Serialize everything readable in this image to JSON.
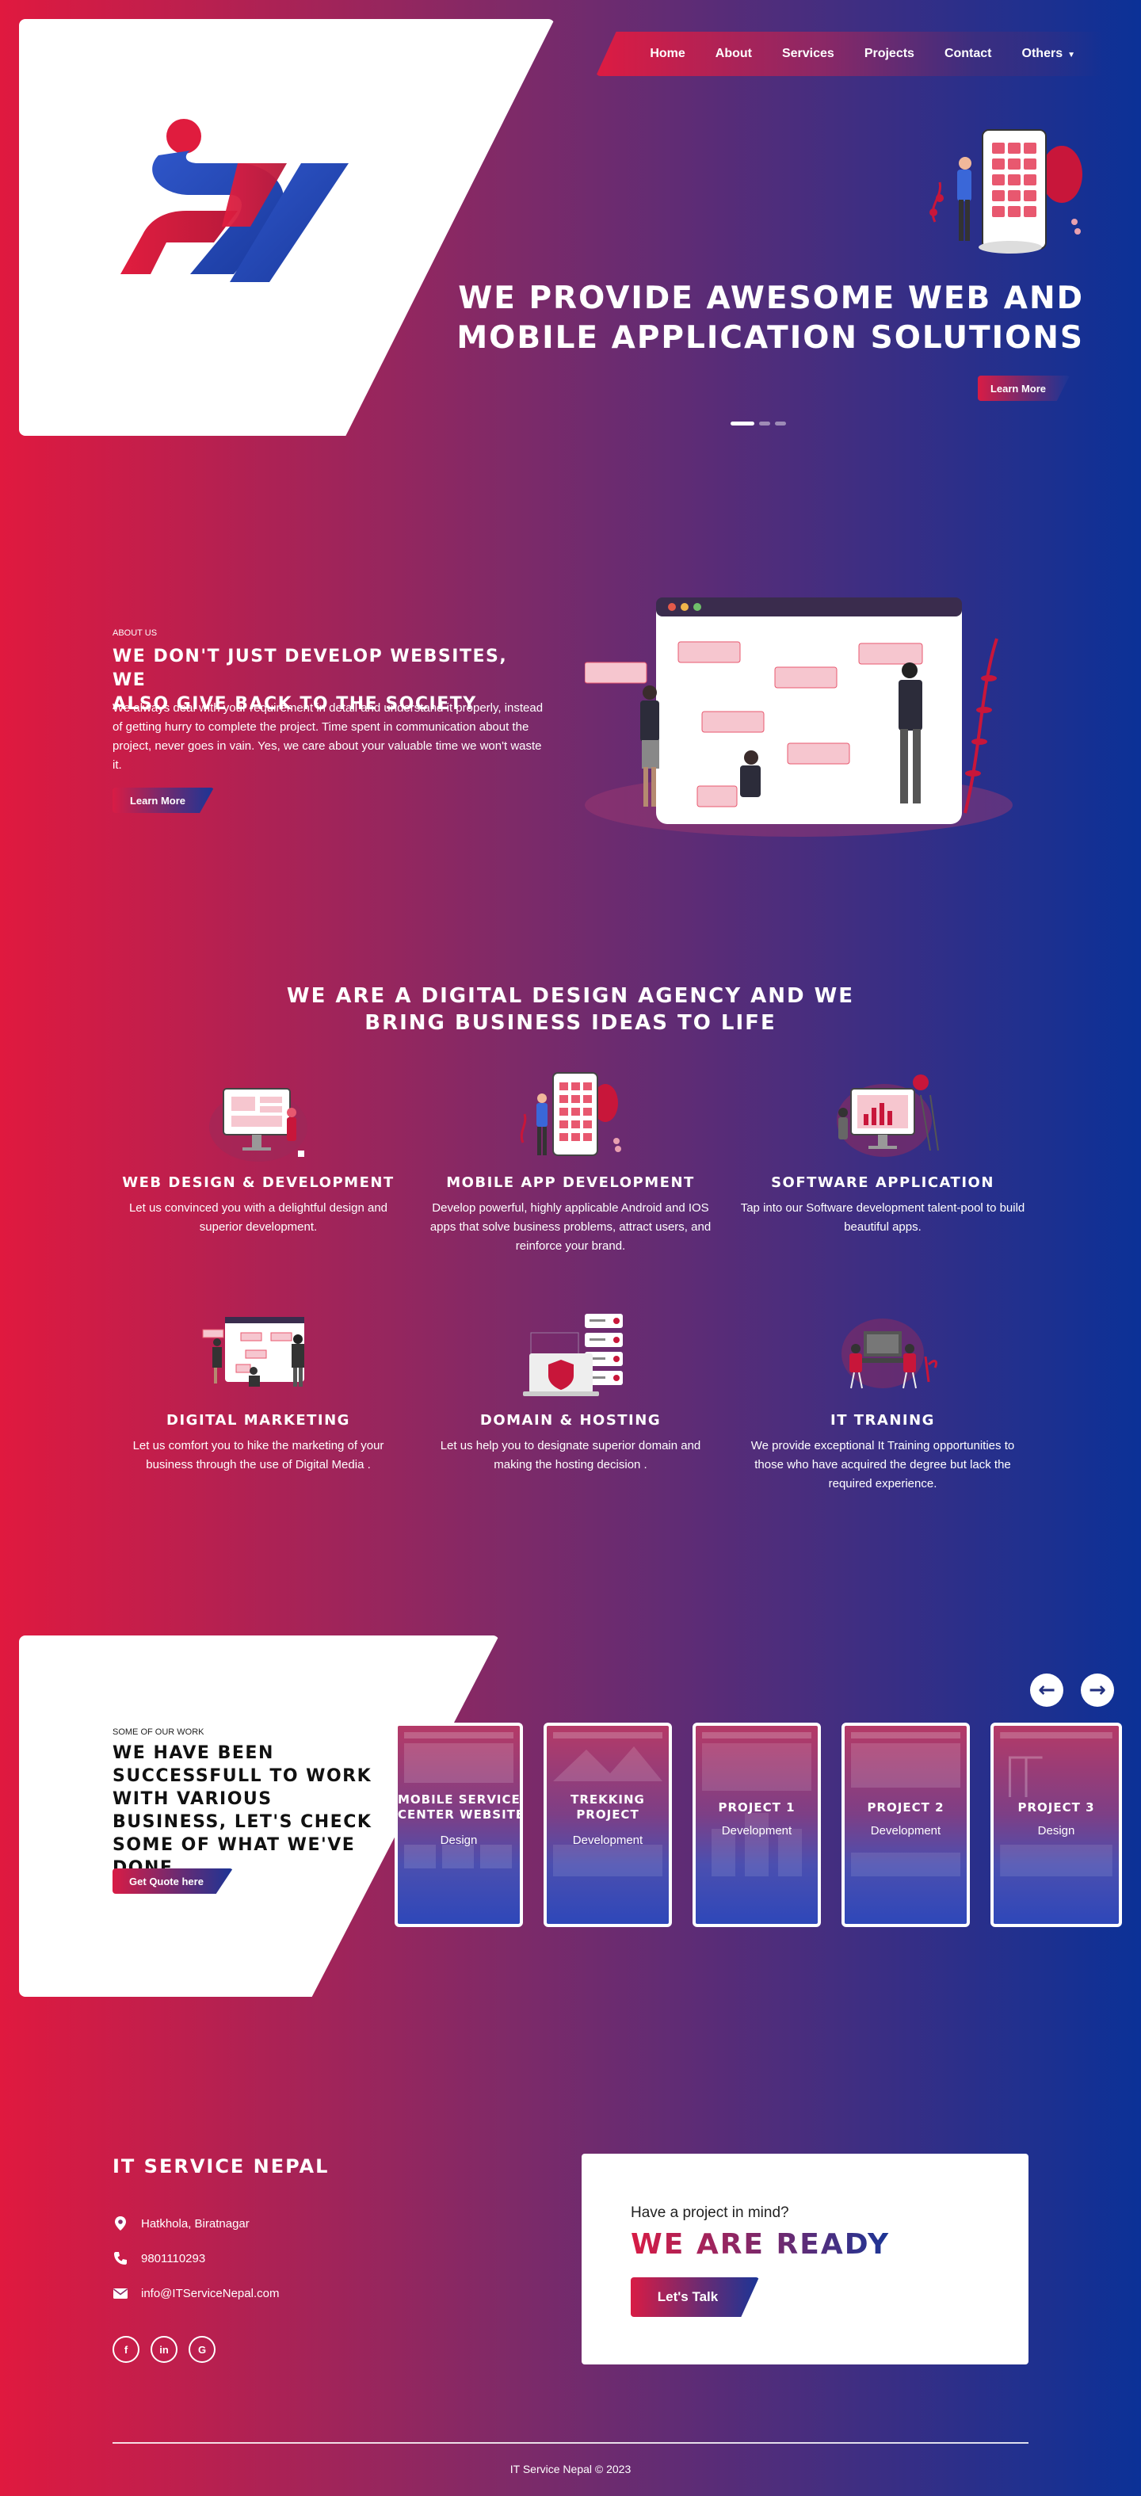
{
  "nav": {
    "items": [
      "Home",
      "About",
      "Services",
      "Projects",
      "Contact",
      "Others"
    ]
  },
  "hero": {
    "title_line1": "WE PROVIDE AWESOME WEB AND",
    "title_line2": "MOBILE APPLICATION SOLUTIONS",
    "button": "Learn More",
    "slides": {
      "count": 3,
      "active": 1
    }
  },
  "about": {
    "eyebrow": "ABOUT US",
    "title_line1": "WE DON'T JUST DEVELOP WEBSITES, WE",
    "title_line2": "ALSO GIVE BACK TO THE SOCIETY",
    "text": "We always deal with your requirement in detail and understand it properly, instead of getting hurry to complete the project. Time spent in communication about the project, never goes in vain. Yes, we care about your valuable time we won't waste it.",
    "button": "Learn More"
  },
  "services": {
    "title_line1": "WE ARE A DIGITAL DESIGN AGENCY AND WE",
    "title_line2": "BRING BUSINESS IDEAS TO LIFE",
    "items": [
      {
        "title": "WEB DESIGN & DEVELOPMENT",
        "desc": "Let us convinced you with a delightful design and superior development.",
        "icon": "monitor-illustration"
      },
      {
        "title": "MOBILE APP DEVELOPMENT",
        "desc": "Develop powerful, highly applicable Android and IOS apps that solve business problems, attract users, and reinforce your brand.",
        "icon": "mobile-illustration"
      },
      {
        "title": "SOFTWARE APPLICATION",
        "desc": "Tap into our Software development talent-pool to build beautiful apps.",
        "icon": "software-illustration"
      },
      {
        "title": "DIGITAL MARKETING",
        "desc": "Let us comfort you to hike the marketing of your business through the use of Digital Media .",
        "icon": "marketing-illustration"
      },
      {
        "title": "DOMAIN & HOSTING",
        "desc": "Let us help you to designate superior domain and making the hosting decision .",
        "icon": "hosting-illustration"
      },
      {
        "title": "IT TRANING",
        "desc": "We provide exceptional It Training opportunities to those who have acquired the degree but lack the required experience.",
        "icon": "training-illustration"
      }
    ]
  },
  "work": {
    "eyebrow": "SOME OF OUR WORK",
    "title": "WE HAVE BEEN SUCCESSFULL TO WORK WITH VARIOUS BUSINESS, LET'S CHECK SOME OF WHAT WE'VE DONE",
    "button": "Get Quote here",
    "prev_icon": "arrow-left-icon",
    "next_icon": "arrow-right-icon",
    "projects": [
      {
        "title_line1": "MOBILE SERVICE",
        "title_line2": "CENTER WEBSITE",
        "category": "Design"
      },
      {
        "title_line1": "TREKKING",
        "title_line2": "PROJECT",
        "category": "Development"
      },
      {
        "title_line1": "PROJECT 1",
        "title_line2": "",
        "category": "Development"
      },
      {
        "title_line1": "PROJECT 2",
        "title_line2": "",
        "category": "Development"
      },
      {
        "title_line1": "PROJECT 3",
        "title_line2": "",
        "category": "Design"
      }
    ]
  },
  "footer": {
    "company": "IT SERVICE NEPAL",
    "address": "Hatkhola, Biratnagar",
    "phone": "9801110293",
    "email": "info@ITServiceNepal.com",
    "social": [
      "f",
      "in",
      "G"
    ],
    "cta_question": "Have a project in mind?",
    "cta_title": "WE ARE READY",
    "cta_button": "Let's Talk",
    "copyright": "IT Service Nepal © 2023"
  },
  "colors": {
    "red": "#e0193f",
    "purple": "#7e2a68",
    "blue": "#0b3197"
  }
}
